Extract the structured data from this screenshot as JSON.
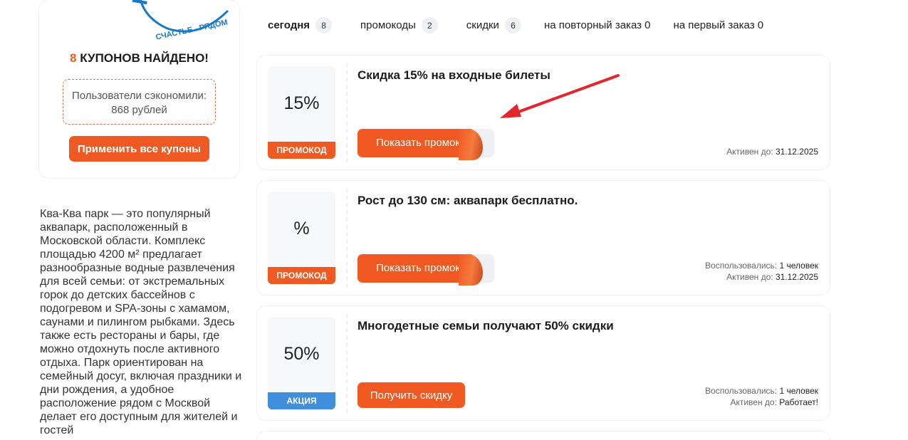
{
  "sidebar": {
    "logo_text": "СЧАСТЬЕ - РЯДОМ",
    "found_count": "8",
    "found_label": "КУПОНОВ НАЙДЕНО!",
    "saved_text": "Пользователи сэкономили: 868 рублей",
    "apply_all_label": "Применить все купоны",
    "description": "Ква-Ква парк — это популярный аквапарк, расположенный в Московской области. Комплекс площадью 4200 м² предлагает разнообразные водные развлечения для всей семьи: от экстремальных горок до детских бассейнов с подогревом и SPA-зоны с хамамом, саунами и пилингом рыбками. Здесь также есть рестораны и бары, где можно отдохнуть после активного отдыха. Парк ориентирован на семейный досуг, включая праздники и дни рождения, а удобное расположение рядом с Москвой делает его доступным для жителей и гостей"
  },
  "tabs": [
    {
      "label": "сегодня",
      "count": "8"
    },
    {
      "label": "промокоды",
      "count": "2"
    },
    {
      "label": "скидки",
      "count": "6"
    },
    {
      "label": "на повторный заказ 0"
    },
    {
      "label": "на первый заказ 0"
    }
  ],
  "coupons": [
    {
      "value": "15%",
      "type": "ПРОМОКОД",
      "title": "Скидка 15% на входные билеты",
      "button": "Показать промокод",
      "active_label": "Активен до:",
      "active_value": "31.12.2025"
    },
    {
      "value": "%",
      "type": "ПРОМОКОД",
      "title": "Рост до 130 см: аквапарк бесплатно.",
      "button": "Показать промокод",
      "used_label": "Воспользовались:",
      "used_value": "1 человек",
      "active_label": "Активен до:",
      "active_value": "31.12.2025"
    },
    {
      "value": "50%",
      "type": "АКЦИЯ",
      "title": "Многодетные семьи получают 50% скидки",
      "button": "Получить скидку",
      "used_label": "Воспользовались:",
      "used_value": "1 человек",
      "active_label": "Активен до:",
      "active_value": "Работает!"
    }
  ],
  "colors": {
    "accent": "#f05a22",
    "promo_blue": "#3f8fdc",
    "arrow": "#e3262b"
  }
}
